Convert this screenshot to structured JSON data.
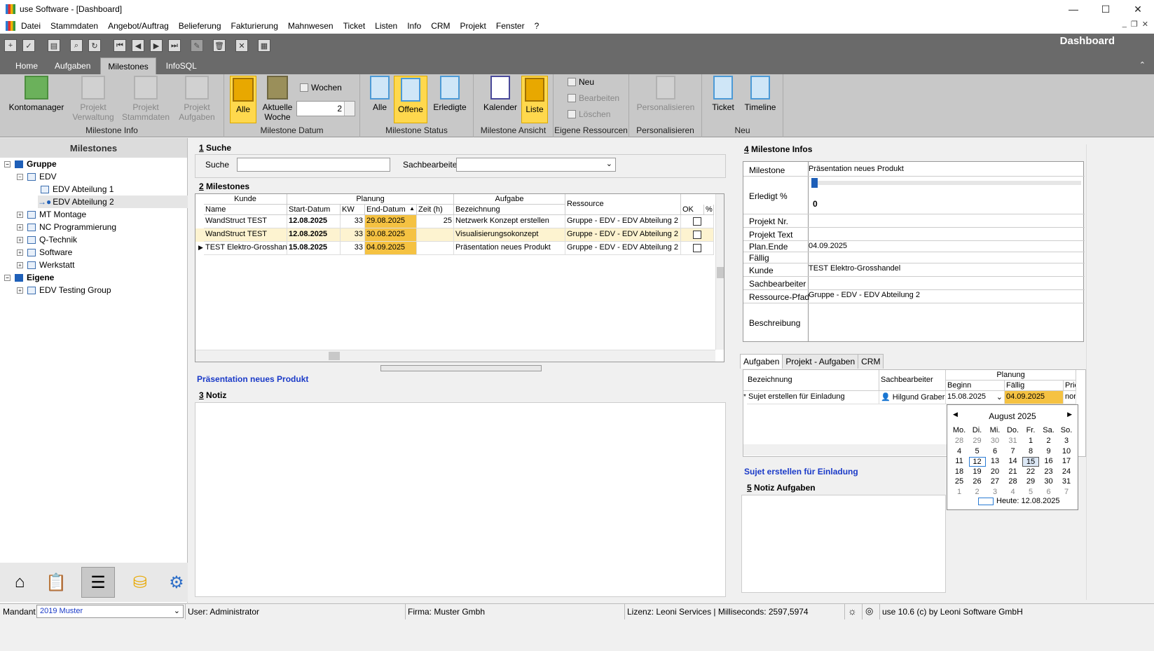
{
  "window": {
    "title": "use Software - [Dashboard]",
    "min": "—",
    "max": "☐",
    "close": "✕"
  },
  "menu": [
    "Datei",
    "Stammdaten",
    "Angebot/Auftrag",
    "Belieferung",
    "Fakturierung",
    "Mahnwesen",
    "Ticket",
    "Listen",
    "Info",
    "CRM",
    "Projekt",
    "Fenster",
    "?"
  ],
  "mdi": {
    "min": "_",
    "restore": "❐",
    "close": "✕"
  },
  "toolbar_title": "Dashboard",
  "tabs": [
    "Home",
    "Aufgaben",
    "Milestones",
    "InfoSQL"
  ],
  "tabs_active": "Milestones",
  "ribbon": {
    "g1": {
      "label": "Milestone Info",
      "b1": "Kontomanager",
      "b2a": "Projekt",
      "b2b": "Verwaltung",
      "b3a": "Projekt",
      "b3b": "Stammdaten",
      "b4a": "Projekt",
      "b4b": "Aufgaben"
    },
    "g2": {
      "label": "Milestone Datum",
      "b1": "Alle",
      "b2a": "Aktuelle",
      "b2b": "Woche",
      "wochen": "Wochen",
      "spin": "2"
    },
    "g3": {
      "label": "Milestone Status",
      "b1": "Alle",
      "b2": "Offene",
      "b3": "Erledigte"
    },
    "g4": {
      "label": "Milestone Ansicht",
      "b1": "Kalender",
      "b2": "Liste"
    },
    "g5": {
      "label": "Eigene Ressourcen",
      "b1": "Neu",
      "b2": "Bearbeiten",
      "b3": "Löschen"
    },
    "g6": {
      "label": "Personalisieren",
      "b1": "Personalisieren"
    },
    "g7": {
      "label": "Neu",
      "b1": "Ticket",
      "b2": "Timeline"
    }
  },
  "left": {
    "title": "Milestones",
    "tree": [
      {
        "t": "Gruppe"
      },
      {
        "t": "EDV"
      },
      {
        "t": "EDV Abteilung 1"
      },
      {
        "t": "EDV Abteilung 2"
      },
      {
        "t": "MT Montage"
      },
      {
        "t": "NC Programmierung"
      },
      {
        "t": "Q-Technik"
      },
      {
        "t": "Software"
      },
      {
        "t": "Werkstatt"
      },
      {
        "t": "Eigene"
      },
      {
        "t": "EDV Testing Group"
      }
    ]
  },
  "suche": {
    "num": "1",
    "title": "Suche",
    "label": "Suche",
    "sb_label": "Sachbearbeiter"
  },
  "milestones": {
    "num": "2",
    "title": "Milestones",
    "groups": {
      "kunde": "Kunde",
      "planung": "Planung",
      "aufgabe": "Aufgabe",
      "ressource": "Ressource"
    },
    "cols": {
      "name": "Name",
      "start": "Start-Datum",
      "kw": "KW",
      "end": "End-Datum",
      "zeit": "Zeit (h)",
      "bez": "Bezeichnung",
      "ok": "OK",
      "pct": "%"
    },
    "rows": [
      {
        "name": "WandStruct TEST",
        "start": "12.08.2025",
        "kw": "33",
        "end": "29.08.2025",
        "zeit": "25",
        "bez": "Netzwerk Konzept erstellen",
        "res": "Gruppe - EDV - EDV Abteilung 2"
      },
      {
        "name": "WandStruct TEST",
        "start": "12.08.2025",
        "kw": "33",
        "end": "30.08.2025",
        "zeit": "",
        "bez": "Visualisierungsokonzept",
        "res": "Gruppe - EDV - EDV Abteilung 2"
      },
      {
        "name": "TEST Elektro-Grosshandel",
        "start": "15.08.2025",
        "kw": "33",
        "end": "04.09.2025",
        "zeit": "",
        "bez": "Präsentation neues Produkt",
        "res": "Gruppe - EDV - EDV Abteilung 2"
      }
    ]
  },
  "selected_title": "Präsentation neues Produkt",
  "notiz": {
    "num": "3",
    "title": "Notiz"
  },
  "infos": {
    "num": "4",
    "title": "Milestone Infos",
    "rows": [
      {
        "k": "Milestone",
        "v": "Präsentation neues Produkt"
      },
      {
        "k": "Erledigt %",
        "v": "0"
      },
      {
        "k": "Projekt Nr.",
        "v": ""
      },
      {
        "k": "Projekt Text",
        "v": ""
      },
      {
        "k": "Plan.Ende",
        "v": "04.09.2025"
      },
      {
        "k": "Fällig",
        "v": ""
      },
      {
        "k": "Kunde",
        "v": "TEST Elektro-Grosshandel"
      },
      {
        "k": "Sachbearbeiter",
        "v": ""
      },
      {
        "k": "Ressource-Pfad",
        "v": "Gruppe - EDV - EDV Abteilung 2"
      },
      {
        "k": "Beschreibung",
        "v": ""
      }
    ]
  },
  "atabs": [
    "Aufgaben",
    "Projekt - Aufgaben",
    "CRM"
  ],
  "agrid": {
    "bez": "Bezeichnung",
    "sb": "Sachbearbeiter",
    "planung": "Planung",
    "beginn": "Beginn",
    "faellig": "Fällig",
    "prio": "Prio",
    "row": {
      "bez": "Sujet erstellen für Einladung",
      "sb": "Hilgund Graber",
      "beginn": "15.08.2025",
      "faellig": "04.09.2025",
      "prio": "nor"
    }
  },
  "calendar": {
    "month": "August 2025",
    "days": [
      "Mo.",
      "Di.",
      "Mi.",
      "Do.",
      "Fr.",
      "Sa.",
      "So."
    ],
    "weeks": [
      [
        "28",
        "29",
        "30",
        "31",
        "1",
        "2",
        "3"
      ],
      [
        "4",
        "5",
        "6",
        "7",
        "8",
        "9",
        "10"
      ],
      [
        "11",
        "12",
        "13",
        "14",
        "15",
        "16",
        "17"
      ],
      [
        "18",
        "19",
        "20",
        "21",
        "22",
        "23",
        "24"
      ],
      [
        "25",
        "26",
        "27",
        "28",
        "29",
        "30",
        "31"
      ],
      [
        "1",
        "2",
        "3",
        "4",
        "5",
        "6",
        "7"
      ]
    ],
    "today": "Heute: 12.08.2025"
  },
  "aufgabe_title": "Sujet erstellen für Einladung",
  "notiz_aufgaben": {
    "num": "5",
    "title": "Notiz Aufgaben"
  },
  "status": {
    "mandant_label": "Mandant",
    "mandant": "2019 Muster",
    "user": "User: Administrator",
    "firma": "Firma: Muster Gmbh",
    "lizenz": "Lizenz: Leoni Services | Milliseconds: 2597,5974",
    "version": "use 10.6 (c) by Leoni Software GmbH"
  }
}
